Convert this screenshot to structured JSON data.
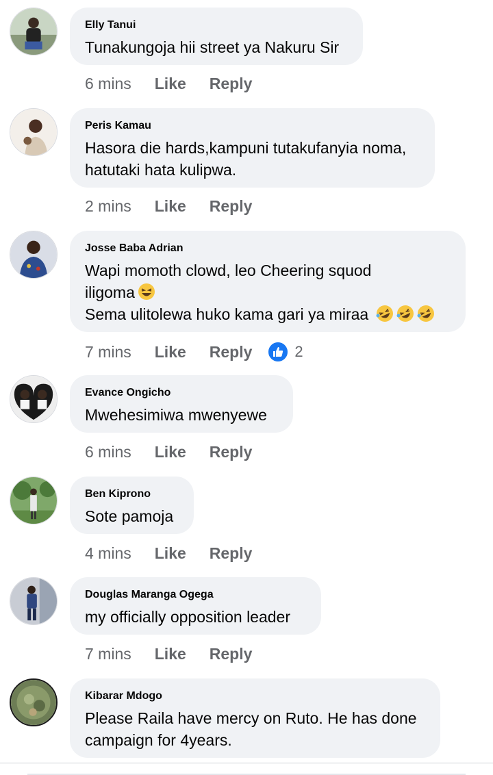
{
  "comments": [
    {
      "author": "Elly Tanui",
      "lines": [
        "Tunakungoja hii street ya Nakuru Sir"
      ],
      "time": "6 mins",
      "like": "Like",
      "reply": "Reply"
    },
    {
      "author": "Peris Kamau",
      "lines": [
        "Hasora die hards,kampuni tutakufanyia noma,",
        "hatutaki hata kulipwa."
      ],
      "time": "2 mins",
      "like": "Like",
      "reply": "Reply"
    },
    {
      "author": "Josse Baba Adrian",
      "lines": [
        "Wapi momoth clowd, leo Cheering squod",
        "iligoma",
        "Sema ulitolewa huko kama gari ya miraa"
      ],
      "time": "7 mins",
      "like": "Like",
      "reply": "Reply",
      "reaction_count": "2"
    },
    {
      "author": "Evance Ongicho",
      "lines": [
        "Mwehesimiwa mwenyewe"
      ],
      "time": "6 mins",
      "like": "Like",
      "reply": "Reply"
    },
    {
      "author": "Ben Kiprono",
      "lines": [
        "Sote pamoja"
      ],
      "time": "4 mins",
      "like": "Like",
      "reply": "Reply"
    },
    {
      "author": "Douglas Maranga Ogega",
      "lines": [
        "my officially opposition leader"
      ],
      "time": "7 mins",
      "like": "Like",
      "reply": "Reply"
    },
    {
      "author": "Kibarar Mdogo",
      "lines": [
        "Please Raila have mercy on Ruto. He has done",
        "campaign for 4years."
      ]
    }
  ],
  "icons": {
    "reaction": "like-thumb-icon",
    "emoji_grin": "grinning-squinting-emoji-icon",
    "emoji_laugh": "rolling-on-floor-laughing-emoji-icon"
  },
  "colors": {
    "bubble": "#f0f2f5",
    "meta_text": "#65676b",
    "like_blue": "#1877f2"
  }
}
